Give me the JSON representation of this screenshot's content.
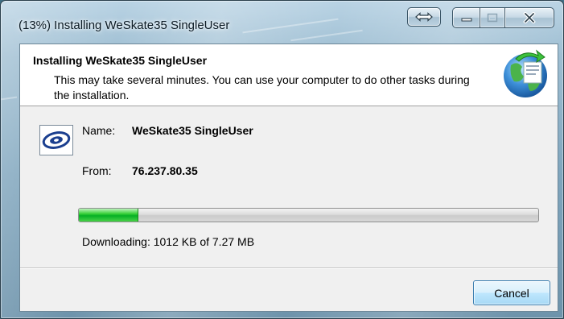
{
  "window": {
    "title": "(13%) Installing WeSkate35 SingleUser"
  },
  "caption_buttons": {
    "switch_icon": "double-arrow-icon",
    "minimize_icon": "minimize-icon",
    "maximize_icon": "maximize-icon",
    "close_icon": "close-icon"
  },
  "header": {
    "title": "Installing WeSkate35 SingleUser",
    "description": "This may take several minutes. You can use your computer to do other tasks during the installation.",
    "icon": "globe-install-icon"
  },
  "app": {
    "icon": "clickonce-app-icon",
    "name_label": "Name:",
    "name_value": "WeSkate35 SingleUser",
    "from_label": "From:",
    "from_value": "76.237.80.35"
  },
  "progress": {
    "percent": 13,
    "status": "Downloading: 1012 KB of 7.27 MB"
  },
  "footer": {
    "cancel_label": "Cancel"
  },
  "colors": {
    "progress_green": "#06b025",
    "header_bg": "#ffffff",
    "dialog_bg": "#f0f0f0"
  }
}
